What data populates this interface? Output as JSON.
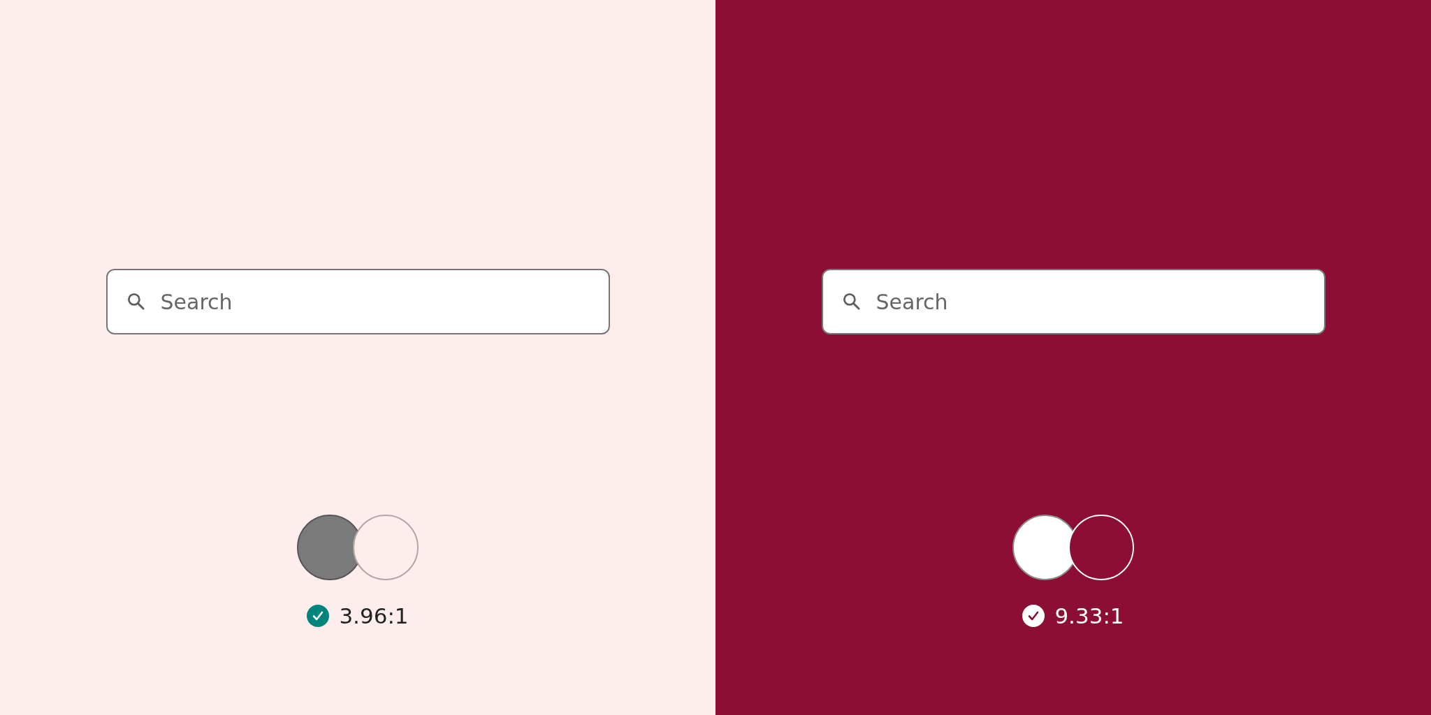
{
  "panels": [
    {
      "kind": "light",
      "color": "#fdeded",
      "search": {
        "placeholder": "Search"
      },
      "swatches": [
        {
          "kind": "text",
          "color": "#7a7a7a"
        },
        {
          "kind": "background",
          "color": "#fdeded"
        }
      ],
      "result": {
        "passed": true,
        "ratio": "3.96:1"
      }
    },
    {
      "kind": "dark",
      "color": "#8c0e35",
      "search": {
        "placeholder": "Search"
      },
      "swatches": [
        {
          "kind": "text",
          "color": "#ffffff"
        },
        {
          "kind": "background",
          "color": "#8c0e35"
        }
      ],
      "result": {
        "passed": true,
        "ratio": "9.33:1"
      }
    }
  ]
}
